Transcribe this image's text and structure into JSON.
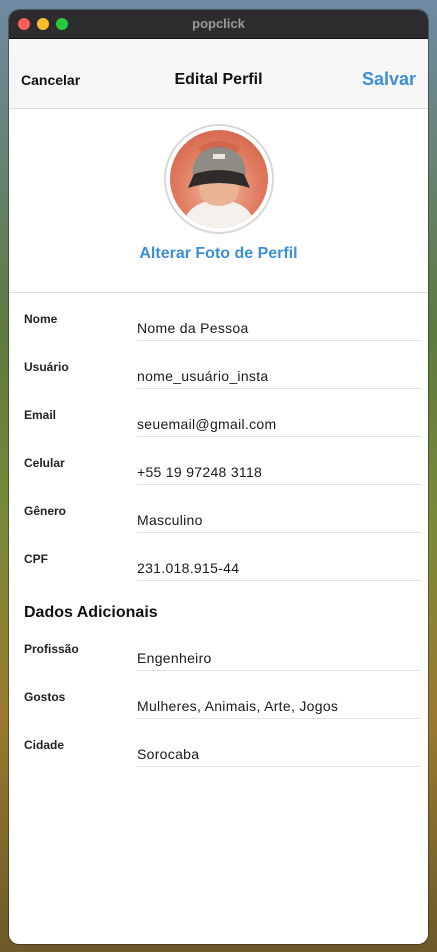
{
  "window": {
    "title": "popclick"
  },
  "navbar": {
    "cancel_label": "Cancelar",
    "title": "Edital Perfil",
    "save_label": "Salvar"
  },
  "profile": {
    "change_photo_label": "Alterar Foto de Perfil"
  },
  "fields": [
    {
      "label": "Nome",
      "value": "Nome da Pessoa"
    },
    {
      "label": "Usuário",
      "value": "nome_usuário_insta"
    },
    {
      "label": "Email",
      "value": "seuemail@gmail.com"
    },
    {
      "label": "Celular",
      "value": "+55 19 97248 3118"
    },
    {
      "label": "Gênero",
      "value": "Masculino"
    },
    {
      "label": "CPF",
      "value": "231.018.915-44"
    }
  ],
  "additional": {
    "title": "Dados Adicionais",
    "fields": [
      {
        "label": "Profissão",
        "value": "Engenheiro"
      },
      {
        "label": "Gostos",
        "value": "Mulheres, Animais, Arte, Jogos"
      },
      {
        "label": "Cidade",
        "value": "Sorocaba"
      }
    ]
  },
  "colors": {
    "accent": "#3b8fd9"
  }
}
